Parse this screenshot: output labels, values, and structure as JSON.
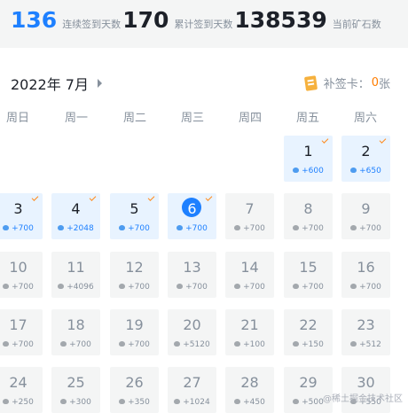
{
  "stats": {
    "consecutive_days": "136",
    "consecutive_label": "连续签到天数",
    "total_days": "170",
    "total_label": "累计签到天数",
    "ore_count": "138539",
    "ore_label": "当前矿石数"
  },
  "calendar": {
    "month_label": "2022年 7月",
    "supplement_label": "补签卡：",
    "supplement_count": "0",
    "supplement_unit": "张",
    "weekdays": [
      "周日",
      "周一",
      "周二",
      "周三",
      "周四",
      "周五",
      "周六"
    ],
    "days": [
      {
        "day": "1",
        "ore": "+600",
        "signed": true,
        "checked": true,
        "today": false
      },
      {
        "day": "2",
        "ore": "+650",
        "signed": true,
        "checked": true,
        "today": false
      },
      {
        "day": "3",
        "ore": "+700",
        "signed": true,
        "checked": true,
        "today": false
      },
      {
        "day": "4",
        "ore": "+2048",
        "signed": true,
        "checked": true,
        "today": false
      },
      {
        "day": "5",
        "ore": "+700",
        "signed": true,
        "checked": true,
        "today": false
      },
      {
        "day": "6",
        "ore": "+700",
        "signed": true,
        "checked": true,
        "today": true
      },
      {
        "day": "7",
        "ore": "+700",
        "signed": false,
        "checked": false,
        "today": false
      },
      {
        "day": "8",
        "ore": "+700",
        "signed": false,
        "checked": false,
        "today": false
      },
      {
        "day": "9",
        "ore": "+700",
        "signed": false,
        "checked": false,
        "today": false
      },
      {
        "day": "10",
        "ore": "+700",
        "signed": false,
        "checked": false,
        "today": false
      },
      {
        "day": "11",
        "ore": "+4096",
        "signed": false,
        "checked": false,
        "today": false
      },
      {
        "day": "12",
        "ore": "+700",
        "signed": false,
        "checked": false,
        "today": false
      },
      {
        "day": "13",
        "ore": "+700",
        "signed": false,
        "checked": false,
        "today": false
      },
      {
        "day": "14",
        "ore": "+700",
        "signed": false,
        "checked": false,
        "today": false
      },
      {
        "day": "15",
        "ore": "+700",
        "signed": false,
        "checked": false,
        "today": false
      },
      {
        "day": "16",
        "ore": "+700",
        "signed": false,
        "checked": false,
        "today": false
      },
      {
        "day": "17",
        "ore": "+700",
        "signed": false,
        "checked": false,
        "today": false
      },
      {
        "day": "18",
        "ore": "+700",
        "signed": false,
        "checked": false,
        "today": false
      },
      {
        "day": "19",
        "ore": "+700",
        "signed": false,
        "checked": false,
        "today": false
      },
      {
        "day": "20",
        "ore": "+5120",
        "signed": false,
        "checked": false,
        "today": false
      },
      {
        "day": "21",
        "ore": "+100",
        "signed": false,
        "checked": false,
        "today": false
      },
      {
        "day": "22",
        "ore": "+150",
        "signed": false,
        "checked": false,
        "today": false
      },
      {
        "day": "23",
        "ore": "+512",
        "signed": false,
        "checked": false,
        "today": false
      },
      {
        "day": "24",
        "ore": "+250",
        "signed": false,
        "checked": false,
        "today": false
      },
      {
        "day": "25",
        "ore": "+300",
        "signed": false,
        "checked": false,
        "today": false
      },
      {
        "day": "26",
        "ore": "+350",
        "signed": false,
        "checked": false,
        "today": false
      },
      {
        "day": "27",
        "ore": "+1024",
        "signed": false,
        "checked": false,
        "today": false
      },
      {
        "day": "28",
        "ore": "+450",
        "signed": false,
        "checked": false,
        "today": false
      },
      {
        "day": "29",
        "ore": "+500",
        "signed": false,
        "checked": false,
        "today": false
      },
      {
        "day": "30",
        "ore": "+550",
        "signed": false,
        "checked": false,
        "today": false
      }
    ]
  },
  "watermark": "@稀土掘金技术社区",
  "colors": {
    "accent": "#1e80ff",
    "signed_bg": "#e8f3ff",
    "cell_bg": "#f4f5f5",
    "check": "#ff8a1c"
  }
}
